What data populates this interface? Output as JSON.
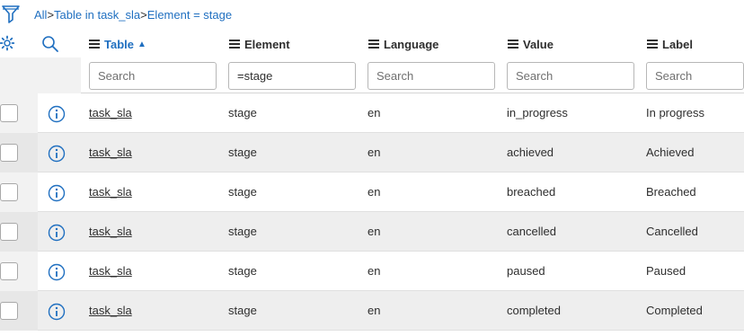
{
  "breadcrumb": {
    "items": [
      "All",
      "Table in task_sla",
      "Element = stage"
    ],
    "separator": ">"
  },
  "columns": [
    {
      "label": "Table",
      "sorted": "ascending",
      "sort_glyph": "▲",
      "search_value": "",
      "search_placeholder": "Search"
    },
    {
      "label": "Element",
      "search_value": "=stage",
      "search_placeholder": "Search"
    },
    {
      "label": "Language",
      "search_value": "",
      "search_placeholder": "Search"
    },
    {
      "label": "Value",
      "search_value": "",
      "search_placeholder": "Search"
    },
    {
      "label": "Label",
      "search_value": "",
      "search_placeholder": "Search"
    }
  ],
  "rows": [
    {
      "table": "task_sla",
      "element": "stage",
      "language": "en",
      "value": "in_progress",
      "label": "In progress"
    },
    {
      "table": "task_sla",
      "element": "stage",
      "language": "en",
      "value": "achieved",
      "label": "Achieved"
    },
    {
      "table": "task_sla",
      "element": "stage",
      "language": "en",
      "value": "breached",
      "label": "Breached"
    },
    {
      "table": "task_sla",
      "element": "stage",
      "language": "en",
      "value": "cancelled",
      "label": "Cancelled"
    },
    {
      "table": "task_sla",
      "element": "stage",
      "language": "en",
      "value": "paused",
      "label": "Paused"
    },
    {
      "table": "task_sla",
      "element": "stage",
      "language": "en",
      "value": "completed",
      "label": "Completed"
    }
  ],
  "icons": {
    "filter": "filter-icon",
    "gear": "gear-icon",
    "search": "search-icon",
    "info": "info-icon",
    "column_menu": "hamburger-menu-icon"
  },
  "colors": {
    "link_blue": "#1f6fc0",
    "row_alt": "#eeeeee",
    "text": "#2e2e2e"
  }
}
